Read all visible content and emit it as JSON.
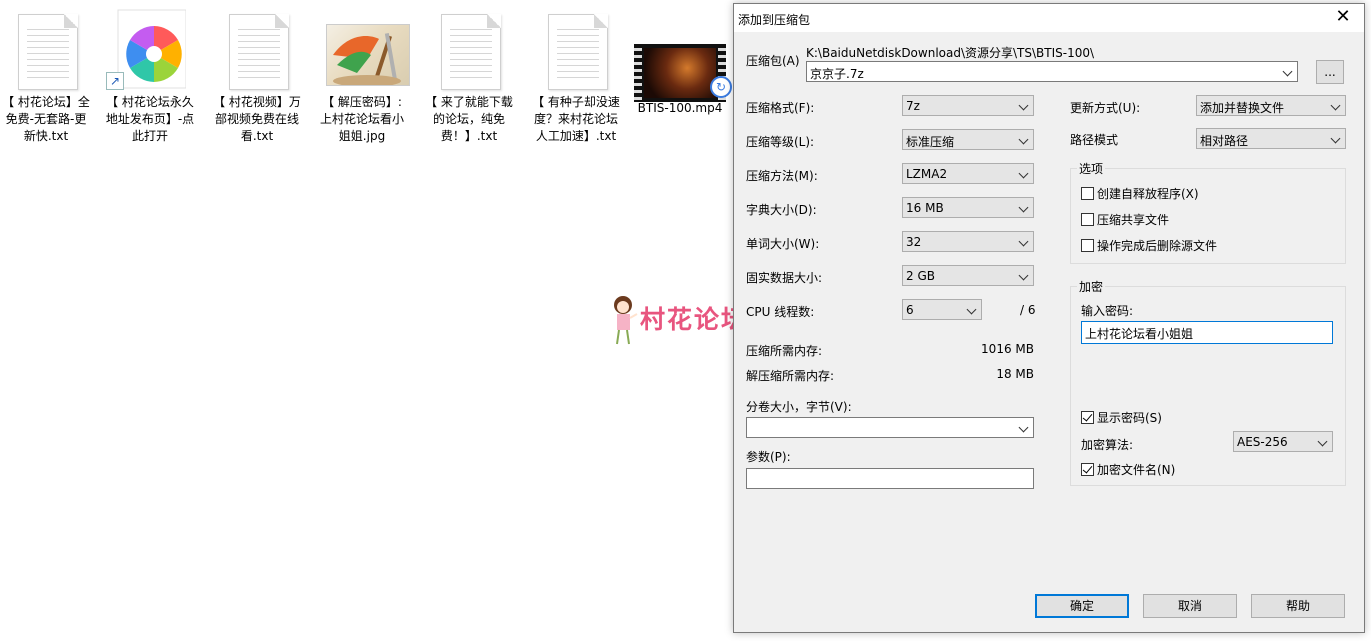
{
  "desktop": {
    "icons": [
      {
        "label": "【 村花论坛】全免费-无套路-更新快.txt",
        "type": "txt"
      },
      {
        "label": "【 村花论坛永久地址发布页】-点此打开",
        "type": "shortcut"
      },
      {
        "label": "【 村花视频】万部视频免费在线看.txt",
        "type": "txt"
      },
      {
        "label": "【 解压密码】: 上村花论坛看小姐姐.jpg",
        "type": "image"
      },
      {
        "label": "【 来了就能下载的论坛，纯免费！】.txt",
        "type": "txt"
      },
      {
        "label": "【 有种子却没速度？来村花论坛人工加速】.txt",
        "type": "txt"
      },
      {
        "label": "BTIS-100.mp4",
        "type": "video"
      }
    ]
  },
  "watermark": {
    "text": "村花论坛"
  },
  "dialog": {
    "title": "添加到压缩包",
    "close_glyph": "✕",
    "archive": {
      "label": "压缩包(A)",
      "path": "K:\\BaiduNetdiskDownload\\资源分享\\TS\\BTIS-100\\",
      "filename": "京京子.7z",
      "browse_label": "..."
    },
    "left": {
      "format": {
        "label": "压缩格式(F):",
        "value": "7z"
      },
      "level": {
        "label": "压缩等级(L):",
        "value": "标准压缩"
      },
      "method": {
        "label": "压缩方法(M):",
        "value": "LZMA2"
      },
      "dict": {
        "label": "字典大小(D):",
        "value": "16 MB"
      },
      "word": {
        "label": "单词大小(W):",
        "value": "32"
      },
      "solid": {
        "label": "固实数据大小:",
        "value": "2 GB"
      },
      "threads": {
        "label": "CPU 线程数:",
        "value": "6",
        "total": "/ 6"
      },
      "mem_compress": {
        "label": "压缩所需内存:",
        "value": "1016 MB"
      },
      "mem_decompress": {
        "label": "解压缩所需内存:",
        "value": "18 MB"
      },
      "split": {
        "label": "分卷大小，字节(V):",
        "value": ""
      },
      "params": {
        "label": "参数(P):",
        "value": ""
      }
    },
    "right": {
      "update": {
        "label": "更新方式(U):",
        "value": "添加并替换文件"
      },
      "path_mode": {
        "label": "路径模式",
        "value": "相对路径"
      },
      "options": {
        "title": "选项",
        "items": [
          {
            "label": "创建自释放程序(X)",
            "checked": false
          },
          {
            "label": "压缩共享文件",
            "checked": false
          },
          {
            "label": "操作完成后删除源文件",
            "checked": false
          }
        ]
      },
      "encryption": {
        "title": "加密",
        "password_label": "输入密码:",
        "password": "上村花论坛看小姐姐",
        "show_password": {
          "label": "显示密码(S)",
          "checked": true
        },
        "method_label": "加密算法:",
        "method": "AES-256",
        "encrypt_names": {
          "label": "加密文件名(N)",
          "checked": true
        }
      }
    },
    "buttons": {
      "ok": "确定",
      "cancel": "取消",
      "help": "帮助"
    }
  }
}
